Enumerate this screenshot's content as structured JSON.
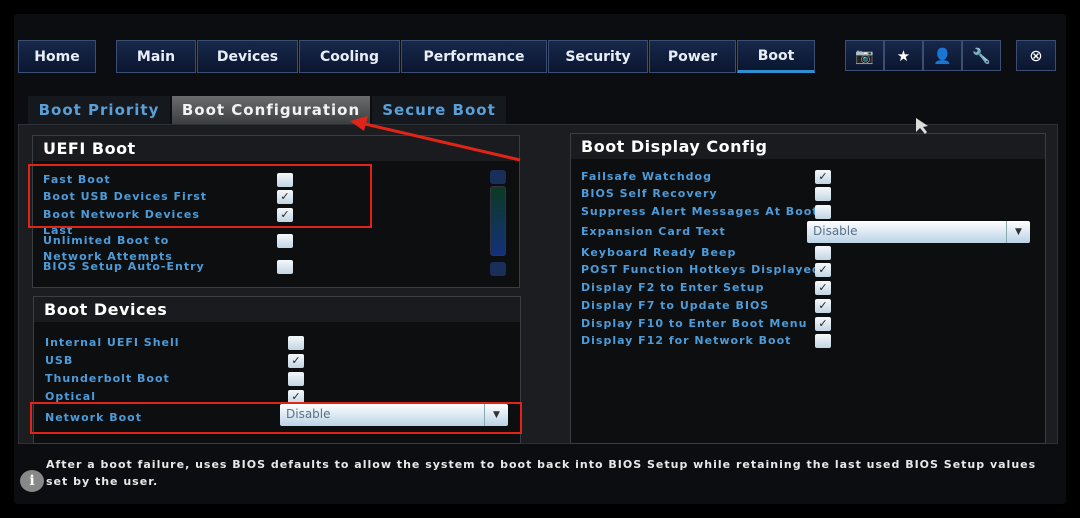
{
  "nav": {
    "home": "Home",
    "tabs": [
      "Main",
      "Devices",
      "Cooling",
      "Performance",
      "Security",
      "Power",
      "Boot"
    ],
    "active_tab": "Boot",
    "icons": [
      "camera-icon",
      "star-icon",
      "user-icon",
      "wrench-icon"
    ],
    "close_icon": "close-circle-icon"
  },
  "subtabs": {
    "items": [
      "Boot Priority",
      "Boot Configuration",
      "Secure Boot"
    ],
    "selected": "Boot Configuration"
  },
  "uefi_boot": {
    "title": "UEFI Boot",
    "items": [
      {
        "label": "Fast Boot",
        "checked": false
      },
      {
        "label": "Boot USB Devices First",
        "checked": true
      },
      {
        "label": "Boot Network Devices Last",
        "checked": true
      },
      {
        "label": "Unlimited Boot to Network Attempts",
        "checked": false
      },
      {
        "label": "BIOS Setup Auto-Entry",
        "checked": false
      }
    ]
  },
  "boot_devices": {
    "title": "Boot Devices",
    "items": [
      {
        "label": "Internal UEFI Shell",
        "checked": false
      },
      {
        "label": "USB",
        "checked": true
      },
      {
        "label": "Thunderbolt Boot",
        "checked": false
      },
      {
        "label": "Optical",
        "checked": true
      }
    ],
    "network_boot": {
      "label": "Network Boot",
      "value": "Disable"
    }
  },
  "boot_display": {
    "title": "Boot Display Config",
    "items": [
      {
        "label": "Failsafe Watchdog",
        "checked": true
      },
      {
        "label": "BIOS Self Recovery",
        "checked": false
      },
      {
        "label": "Suppress Alert Messages At Boot",
        "checked": false
      },
      {
        "label": "Expansion Card Text",
        "dropdown": "Disable"
      },
      {
        "label": "Keyboard Ready Beep",
        "checked": false
      },
      {
        "label": "POST Function Hotkeys Displayed",
        "checked": true
      },
      {
        "label": "Display F2 to Enter Setup",
        "checked": true
      },
      {
        "label": "Display F7 to Update BIOS",
        "checked": true
      },
      {
        "label": "Display F10 to Enter Boot Menu",
        "checked": true
      },
      {
        "label": "Display F12 for Network Boot",
        "checked": false
      }
    ]
  },
  "help": {
    "icon": "info-icon",
    "text": "After a boot failure, uses BIOS defaults to allow the system to boot back into BIOS Setup while retaining the last used BIOS Setup values set by the user."
  },
  "colors": {
    "accent": "#2e8fd0",
    "label": "#4d9bd8",
    "highlight": "#e02418"
  }
}
